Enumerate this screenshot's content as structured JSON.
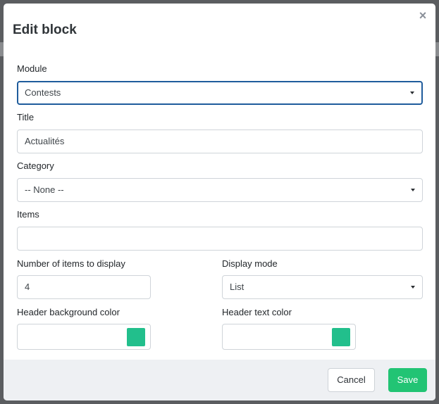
{
  "dialog": {
    "title": "Edit block",
    "close_icon": "close-icon",
    "close_glyph": "×"
  },
  "form": {
    "module": {
      "label": "Module",
      "value": "Contests"
    },
    "title": {
      "label": "Title",
      "value": "Actualités"
    },
    "category": {
      "label": "Category",
      "value": "-- None --"
    },
    "items": {
      "label": "Items",
      "value": ""
    },
    "num_items": {
      "label": "Number of items to display",
      "value": "4"
    },
    "display_mode": {
      "label": "Display mode",
      "value": "List"
    },
    "header_bg": {
      "label": "Header background color",
      "swatch_color": "#22bf8c"
    },
    "header_text": {
      "label": "Header text color",
      "swatch_color": "#22bf8c"
    }
  },
  "footer": {
    "cancel_label": "Cancel",
    "save_label": "Save"
  },
  "colors": {
    "focus_border": "#1f5c9c",
    "save_button": "#22c474"
  }
}
